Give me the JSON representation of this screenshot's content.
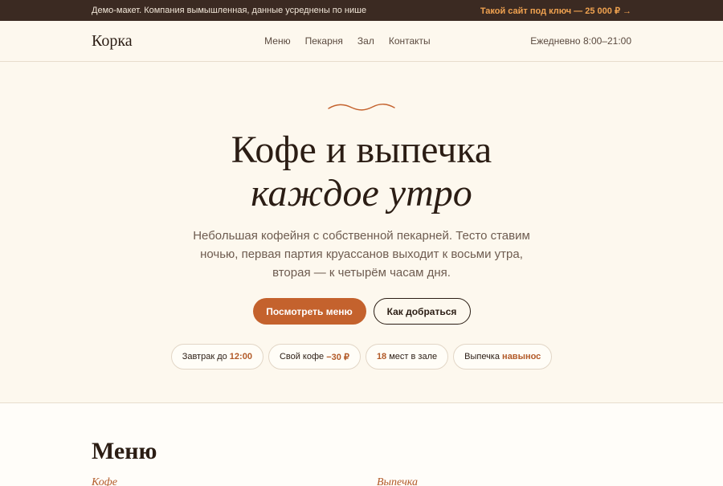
{
  "topbar": {
    "disclaimer": "Демо-макет. Компания вымышленная, данные усреднены по нише",
    "promo": "Такой сайт под ключ — 25 000 ₽ →"
  },
  "nav": {
    "logo": "Корка",
    "items": [
      "Меню",
      "Пекарня",
      "Зал",
      "Контакты"
    ],
    "hours": "Ежедневно 8:00–21:00"
  },
  "hero": {
    "title_line1": "Кофе и выпечка",
    "title_line2": "каждое утро",
    "lead": "Небольшая кофейня с собственной пекарней. Тесто ставим ночью, первая партия круассанов выходит к восьми утра, вторая — к четырём часам дня.",
    "primary_button": "Посмотреть меню",
    "secondary_button": "Как добраться",
    "chips": [
      {
        "pre": "Завтрак до ",
        "accent": "12:00",
        "post": ""
      },
      {
        "pre": "Свой кофе ",
        "accent": "−30 ₽",
        "post": ""
      },
      {
        "pre": "",
        "accent": "18",
        "post": " мест в зале"
      },
      {
        "pre": "Выпечка ",
        "accent": "навынос",
        "post": ""
      }
    ]
  },
  "menu_section": {
    "title": "Меню",
    "categories": [
      "Кофе",
      "Выпечка"
    ]
  },
  "colors": {
    "accent": "#c4622d",
    "dark": "#3b2a22",
    "background": "#fdf8ee"
  }
}
